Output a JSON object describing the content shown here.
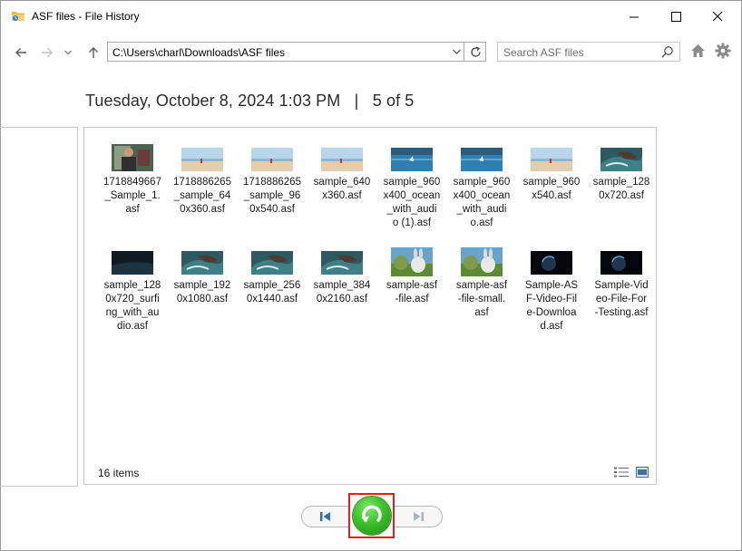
{
  "window": {
    "title": "ASF files - File History",
    "controls": {
      "minimize": "minimize",
      "maximize": "maximize",
      "close": "close"
    }
  },
  "nav": {
    "address": "C:\\Users\\charl\\Downloads\\ASF files",
    "search_placeholder": "Search ASF files"
  },
  "header": {
    "date": "Tuesday, October 8, 2024 1:03 PM",
    "separator": "|",
    "version": "5 of 5"
  },
  "files": [
    {
      "name": "1718849667_Sample_1.asf",
      "label": "1718849667\n_Sample_1.\nasf",
      "thumb": "person"
    },
    {
      "name": "1718886265_sample_640x360.asf",
      "label": "1718886265\n_sample_64\n0x360.asf",
      "thumb": "beach"
    },
    {
      "name": "1718886265_sample_960x540.asf",
      "label": "1718886265\n_sample_96\n0x540.asf",
      "thumb": "beach"
    },
    {
      "name": "sample_640x360.asf",
      "label": "sample_640\nx360.asf",
      "thumb": "beach"
    },
    {
      "name": "sample_960x400_ocean_with_audio (1).asf",
      "label": "sample_960\nx400_ocean\n_with_audi\no (1).asf",
      "thumb": "ocean"
    },
    {
      "name": "sample_960x400_ocean_with_audio.asf",
      "label": "sample_960\nx400_ocean\n_with_audi\no.asf",
      "thumb": "ocean"
    },
    {
      "name": "sample_960x540.asf",
      "label": "sample_960\nx540.asf",
      "thumb": "beach"
    },
    {
      "name": "sample_1280x720.asf",
      "label": "sample_128\n0x720.asf",
      "thumb": "wave"
    },
    {
      "name": "sample_1280x720_surfing_with_audio.asf",
      "label": "sample_128\n0x720_surfi\nng_with_au\ndio.asf",
      "thumb": "dark"
    },
    {
      "name": "sample_1920x1080.asf",
      "label": "sample_192\n0x1080.asf",
      "thumb": "wave"
    },
    {
      "name": "sample_2560x1440.asf",
      "label": "sample_256\n0x1440.asf",
      "thumb": "wave"
    },
    {
      "name": "sample_3840x2160.asf",
      "label": "sample_384\n0x2160.asf",
      "thumb": "wave"
    },
    {
      "name": "sample-asf-file.asf",
      "label": "sample-asf\n-file.asf",
      "thumb": "bunny"
    },
    {
      "name": "sample-asf-file-small.asf",
      "label": "sample-asf\n-file-small.\nasf",
      "thumb": "bunny"
    },
    {
      "name": "Sample-ASF-Video-File-Download.asf",
      "label": "Sample-AS\nF-Video-Fil\ne-Downloa\nd.asf",
      "thumb": "planet"
    },
    {
      "name": "Sample-Video-File-For-Testing.asf",
      "label": "Sample-Vid\neo-File-For\n-Testing.asf",
      "thumb": "planet"
    }
  ],
  "status": {
    "item_count": "16 items"
  },
  "controls": {
    "previous": "previous-version",
    "restore": "restore",
    "next": "next-version"
  },
  "colors": {
    "restore_green": "#3cc02a",
    "highlight_red": "#e02020",
    "folder_yellow": "#e8b838"
  },
  "icons": [
    "folder-icon",
    "back-arrow-icon",
    "forward-arrow-icon",
    "chevron-down-icon",
    "up-arrow-icon",
    "refresh-icon",
    "search-icon",
    "home-icon",
    "gear-icon",
    "details-view-icon",
    "large-icons-view-icon",
    "previous-icon",
    "restore-icon",
    "next-icon"
  ]
}
